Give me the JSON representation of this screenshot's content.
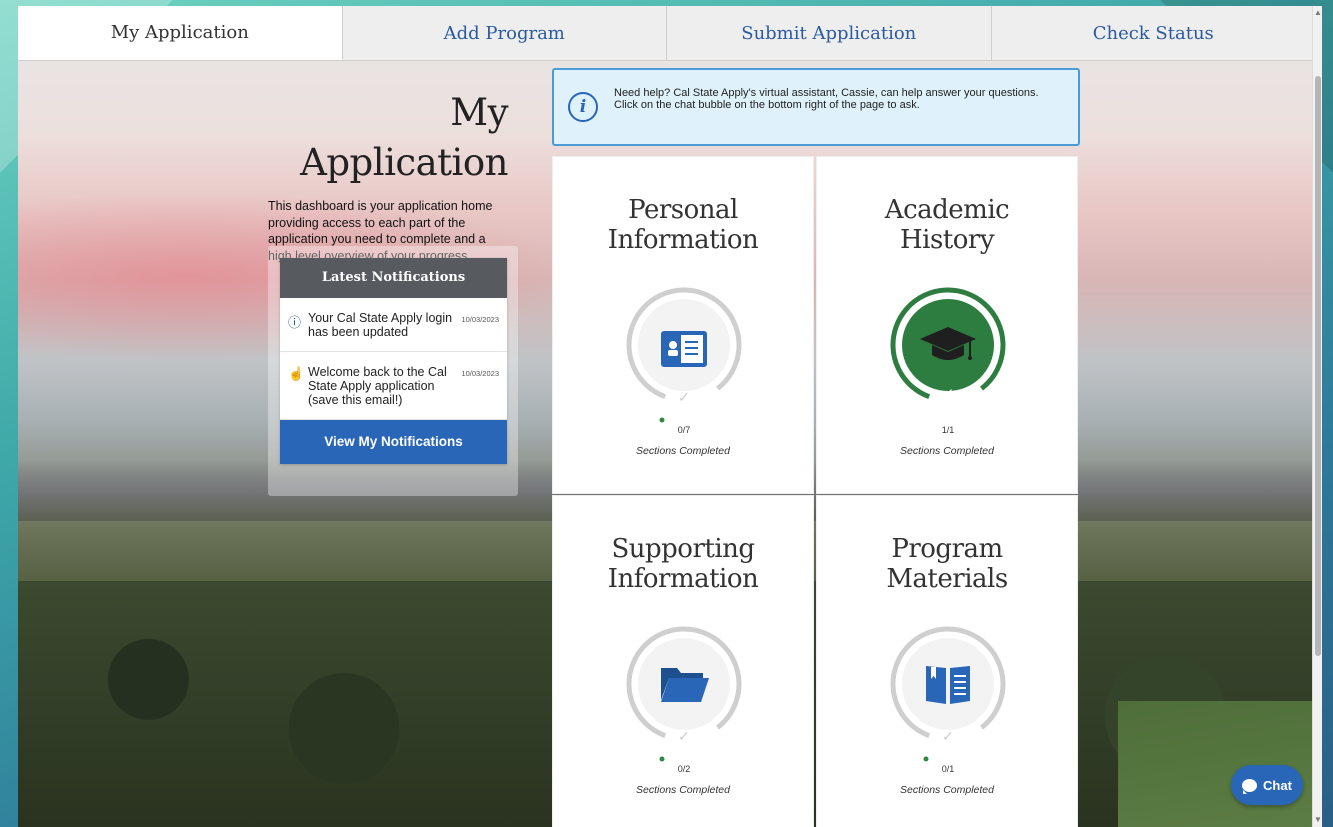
{
  "tabs": [
    {
      "label": "My Application",
      "active": true
    },
    {
      "label": "Add Program",
      "active": false
    },
    {
      "label": "Submit Application",
      "active": false
    },
    {
      "label": "Check Status",
      "active": false
    }
  ],
  "intro": {
    "title": "My Application",
    "description": "This dashboard is your application home providing access to each part of the application you need to complete and a high level overview of your progress."
  },
  "notifications": {
    "header": "Latest Notifications",
    "items": [
      {
        "icon": "info-icon",
        "text": "Your Cal State Apply login has been updated",
        "date": "10/03/2023"
      },
      {
        "icon": "hand-wave-icon",
        "text": "Welcome back to the Cal State Apply application (save this email!)",
        "date": "10/03/2023"
      }
    ],
    "button_label": "View My Notifications"
  },
  "help": {
    "icon": "info-icon",
    "text": "Need help? Cal State Apply's virtual assistant, Cassie, can help answer your questions. Click on the chat bubble on the bottom right of the page to ask."
  },
  "tiles": [
    {
      "title_line1": "Personal",
      "title_line2": "Information",
      "icon": "id-card-icon",
      "progress": "0/7",
      "completed": 0,
      "total": 7,
      "caption": "Sections Completed"
    },
    {
      "title_line1": "Academic",
      "title_line2": "History",
      "icon": "graduation-cap-icon",
      "progress": "1/1",
      "completed": 1,
      "total": 1,
      "caption": "Sections Completed"
    },
    {
      "title_line1": "Supporting",
      "title_line2": "Information",
      "icon": "folder-icon",
      "progress": "0/2",
      "completed": 0,
      "total": 2,
      "caption": "Sections Completed"
    },
    {
      "title_line1": "Program",
      "title_line2": "Materials",
      "icon": "book-icon",
      "progress": "0/1",
      "completed": 0,
      "total": 1,
      "caption": "Sections Completed"
    }
  ],
  "chat": {
    "label": "Chat"
  },
  "colors": {
    "brand_blue": "#2a66b8",
    "complete_green": "#2e7d40",
    "notif_header": "#575a5e",
    "help_bg": "#dff2fb"
  }
}
